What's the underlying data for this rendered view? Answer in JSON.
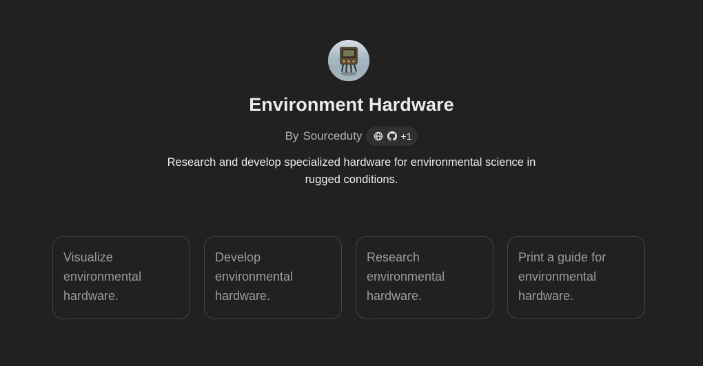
{
  "gpt": {
    "name": "Environment Hardware",
    "byline_prefix": "By",
    "author": "Sourceduty",
    "links_extra": "+1",
    "description": "Research and develop specialized hardware for environmental science in rugged conditions."
  },
  "icons": {
    "website": "globe-icon",
    "repo": "github-icon"
  },
  "starters": [
    {
      "label": "Visualize environmental hardware."
    },
    {
      "label": "Develop environmental hardware."
    },
    {
      "label": "Research environmental hardware."
    },
    {
      "label": "Print a guide for environmental hardware."
    }
  ],
  "colors": {
    "background": "#212121",
    "text": "#ececec",
    "muted": "#b4b4b4",
    "card_border": "#444444",
    "card_text": "#9b9b9b",
    "pill": "#303030"
  }
}
